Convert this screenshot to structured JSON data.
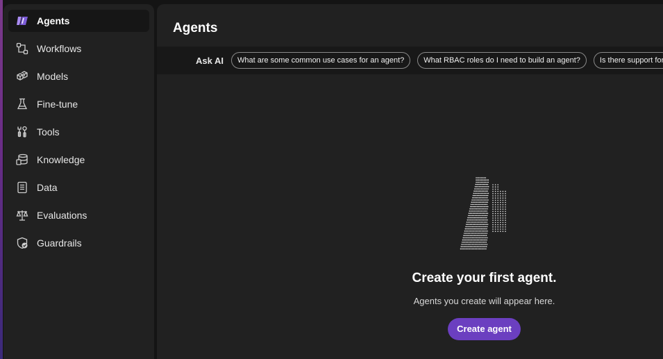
{
  "sidebar": {
    "items": [
      {
        "label": "Agents",
        "icon": "agents-logo-icon",
        "active": true
      },
      {
        "label": "Workflows",
        "icon": "workflow-icon"
      },
      {
        "label": "Models",
        "icon": "cubes-icon"
      },
      {
        "label": "Fine-tune",
        "icon": "flask-icon"
      },
      {
        "label": "Tools",
        "icon": "tools-icon"
      },
      {
        "label": "Knowledge",
        "icon": "database-icon"
      },
      {
        "label": "Data",
        "icon": "document-icon"
      },
      {
        "label": "Evaluations",
        "icon": "scales-icon"
      },
      {
        "label": "Guardrails",
        "icon": "shield-check-icon"
      }
    ]
  },
  "main": {
    "title": "Agents",
    "ask_ai": {
      "label": "Ask AI",
      "suggestions": [
        "What are some common use cases for an agent?",
        "What RBAC roles do I need to build an agent?",
        "Is there support for"
      ]
    },
    "empty_state": {
      "illustration": "dotted-agents-illustration",
      "title": "Create your first agent.",
      "subtitle": "Agents you create will appear here.",
      "button_label": "Create agent"
    }
  },
  "colors": {
    "accent": "#6b3fc0",
    "sidebar_bg": "#212121",
    "active_item_bg": "#161616",
    "askbar_bg": "#181818",
    "logo_purple": "#a98bf2"
  }
}
